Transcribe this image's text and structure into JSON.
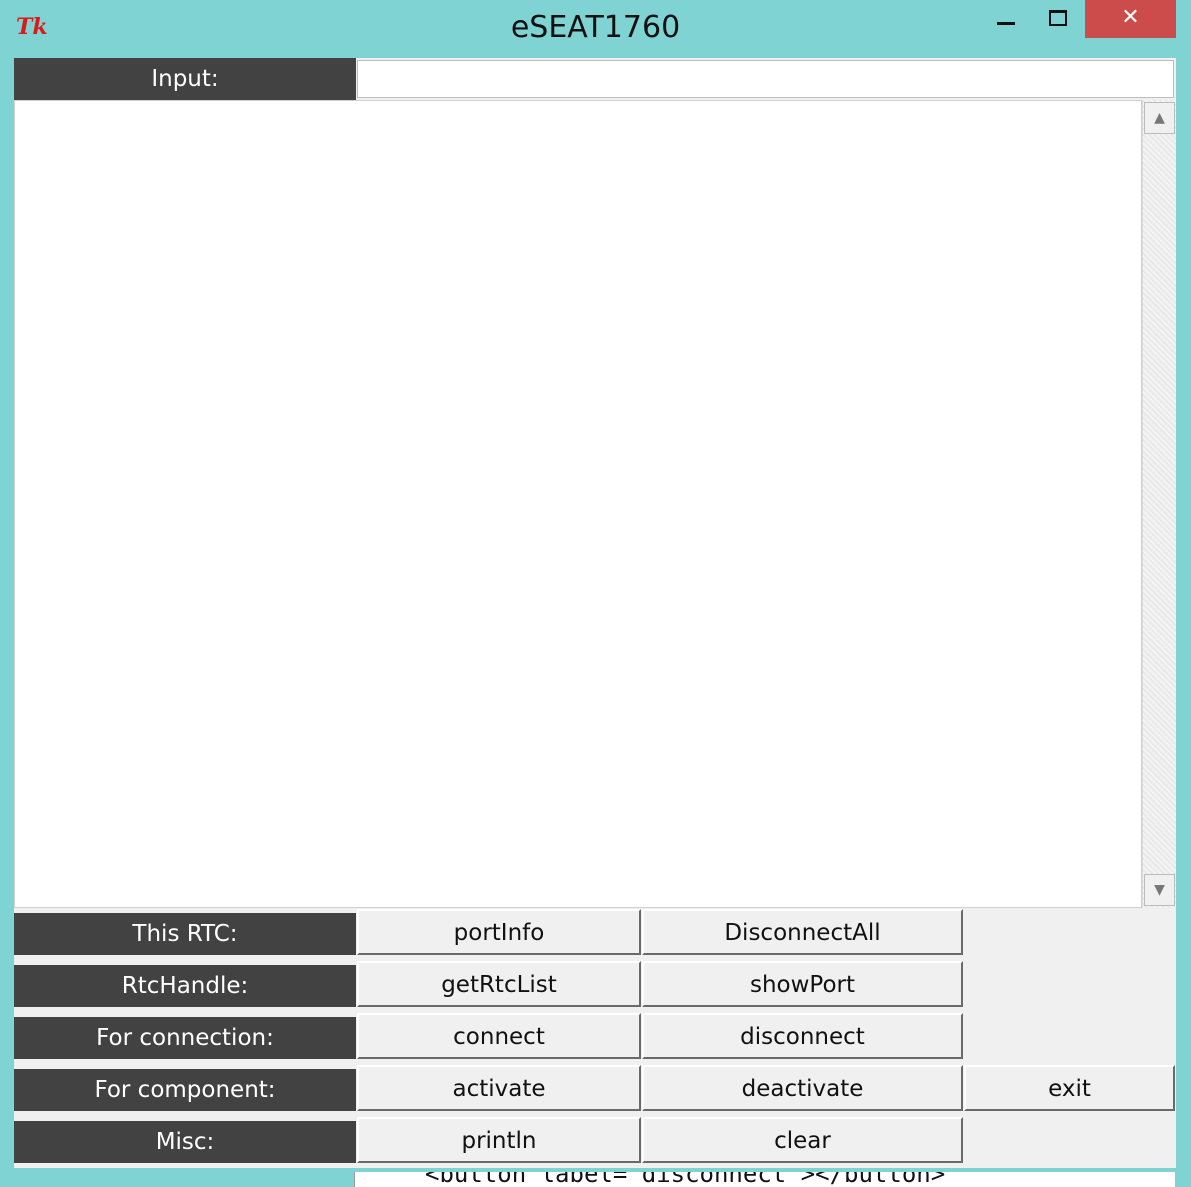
{
  "window": {
    "title": "eSEAT1760",
    "app_icon": "Tk",
    "close_glyph": "✕"
  },
  "input": {
    "label": "Input:",
    "value": ""
  },
  "scrollbar": {
    "up_glyph": "▲",
    "down_glyph": "▼"
  },
  "rows": [
    {
      "label": "This RTC:",
      "buttons": [
        "portInfo",
        "DisconnectAll"
      ]
    },
    {
      "label": "RtcHandle:",
      "buttons": [
        "getRtcList",
        "showPort"
      ]
    },
    {
      "label": "For connection:",
      "buttons": [
        "connect",
        "disconnect"
      ]
    },
    {
      "label": "For component:",
      "buttons": [
        "activate",
        "deactivate",
        "exit"
      ]
    },
    {
      "label": "Misc:",
      "buttons": [
        "println",
        "clear"
      ]
    }
  ],
  "clipped_text": "<button label=\"disconnect\"></button>"
}
